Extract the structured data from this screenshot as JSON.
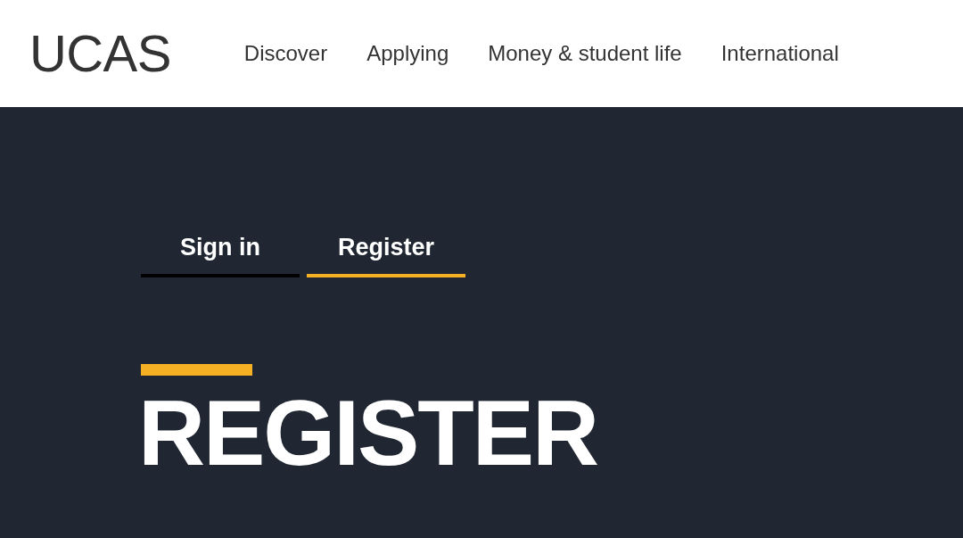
{
  "header": {
    "logo": "UCAS",
    "nav": [
      "Discover",
      "Applying",
      "Money & student life",
      "International"
    ]
  },
  "tabs": [
    {
      "label": "Sign in",
      "selected": false
    },
    {
      "label": "Register",
      "selected": true
    }
  ],
  "heading": "REGISTER"
}
